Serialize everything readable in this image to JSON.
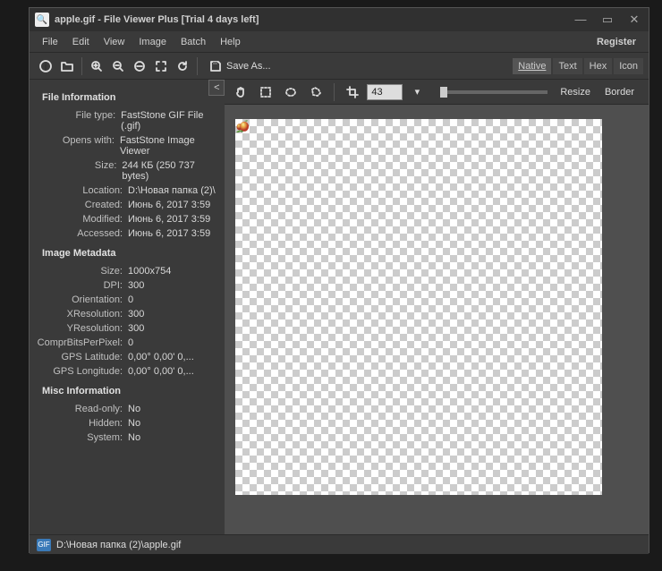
{
  "title": "apple.gif - File Viewer Plus [Trial 4 days left]",
  "menu": {
    "file": "File",
    "edit": "Edit",
    "view": "View",
    "image": "Image",
    "batch": "Batch",
    "help": "Help",
    "register": "Register"
  },
  "toolbar": {
    "saveas": "Save As..."
  },
  "viewtabs": {
    "native": "Native",
    "text": "Text",
    "hex": "Hex",
    "icon": "Icon"
  },
  "canvasTools": {
    "cropValue": "43",
    "resize": "Resize",
    "border": "Border"
  },
  "sidebar": {
    "fileInfoHeader": "File Information",
    "fileInfo": [
      {
        "k": "File type:",
        "v": "FastStone GIF File (.gif)"
      },
      {
        "k": "Opens with:",
        "v": "FastStone Image Viewer"
      },
      {
        "k": "Size:",
        "v": "244 КБ (250 737 bytes)"
      },
      {
        "k": "Location:",
        "v": "D:\\Новая папка (2)\\"
      },
      {
        "k": "Created:",
        "v": "Июнь 6, 2017 3:59"
      },
      {
        "k": "Modified:",
        "v": "Июнь 6, 2017 3:59"
      },
      {
        "k": "Accessed:",
        "v": "Июнь 6, 2017 3:59"
      }
    ],
    "metaHeader": "Image Metadata",
    "meta": [
      {
        "k": "Size:",
        "v": "1000x754"
      },
      {
        "k": "DPI:",
        "v": "300"
      },
      {
        "k": "Orientation:",
        "v": "0"
      },
      {
        "k": "XResolution:",
        "v": "300"
      },
      {
        "k": "YResolution:",
        "v": "300"
      },
      {
        "k": "ComprBitsPerPixel:",
        "v": "0"
      },
      {
        "k": "GPS Latitude:",
        "v": "0,00° 0,00' 0,..."
      },
      {
        "k": "GPS Longitude:",
        "v": "0,00° 0,00' 0,..."
      }
    ],
    "miscHeader": "Misc Information",
    "misc": [
      {
        "k": "Read-only:",
        "v": "No"
      },
      {
        "k": "Hidden:",
        "v": "No"
      },
      {
        "k": "System:",
        "v": "No"
      }
    ]
  },
  "status": {
    "path": "D:\\Новая папка (2)\\apple.gif",
    "icon": "GIF"
  }
}
